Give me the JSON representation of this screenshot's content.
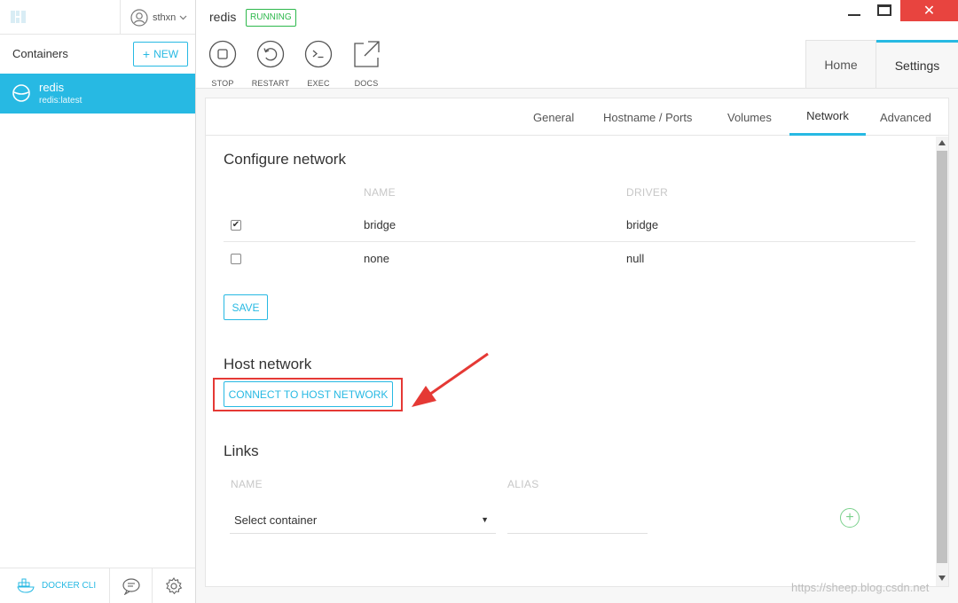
{
  "sidebar": {
    "user": "sthxn",
    "containers_title": "Containers",
    "new_label": "NEW",
    "containers": [
      {
        "name": "redis",
        "image": "redis:latest"
      }
    ],
    "docker_cli_label": "DOCKER CLI"
  },
  "header": {
    "title": "redis",
    "status": "RUNNING"
  },
  "toolbar": {
    "stop": "STOP",
    "restart": "RESTART",
    "exec": "EXEC",
    "docs": "DOCS"
  },
  "main_tabs": {
    "home": "Home",
    "settings": "Settings"
  },
  "settings_tabs": {
    "general": "General",
    "hostname": "Hostname / Ports",
    "volumes": "Volumes",
    "network": "Network",
    "advanced": "Advanced"
  },
  "configure_network": {
    "title": "Configure network",
    "col_name": "NAME",
    "col_driver": "DRIVER",
    "rows": [
      {
        "name": "bridge",
        "driver": "bridge",
        "checked": "✔"
      },
      {
        "name": "none",
        "driver": "null",
        "checked": ""
      }
    ],
    "save_label": "SAVE"
  },
  "host_network": {
    "title": "Host network",
    "connect_label": "CONNECT TO HOST NETWORK"
  },
  "links": {
    "title": "Links",
    "col_name": "NAME",
    "col_alias": "ALIAS",
    "select_value": "Select container",
    "add_symbol": "+"
  },
  "watermark": "https://sheep.blog.csdn.net",
  "colors": {
    "accent": "#27b9e3",
    "running": "#2db84c",
    "close": "#e8443f",
    "annotation": "#e53935"
  }
}
